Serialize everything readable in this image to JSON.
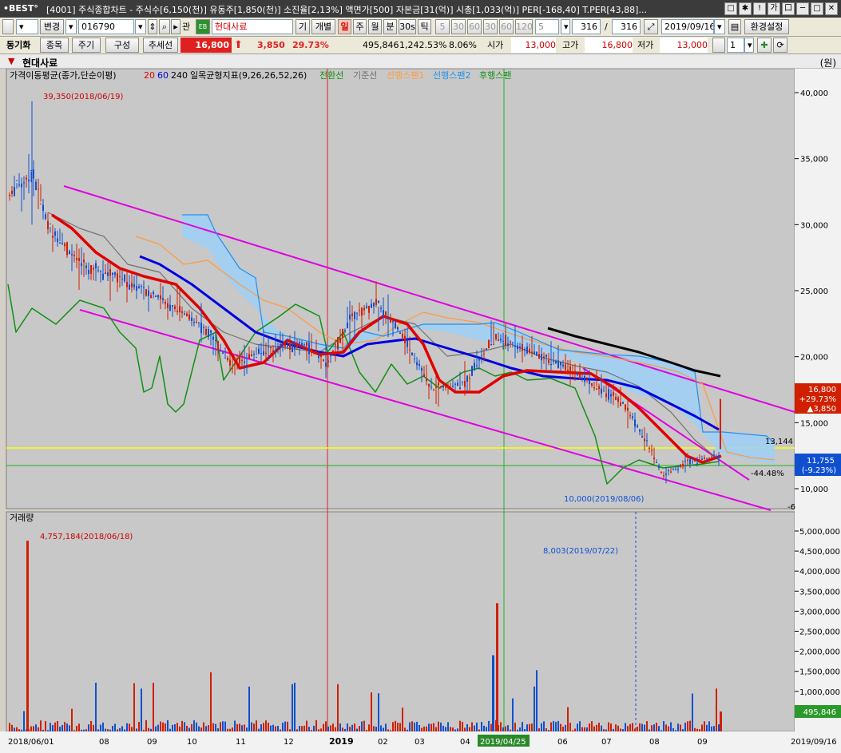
{
  "window": {
    "logo": "•BEST°",
    "title": "[4001] 주식종합차트 - 주식수[6,150(천)] 유동주[1,850(천)] 소진율[2,13%] 액면가[500] 자본금[31(억)] 시총[1,033(억)] PER[-168,40] T.PER[43,88]...",
    "buttons": [
      "□",
      "✱",
      "!",
      "가",
      "口",
      "─",
      "□",
      "✕"
    ]
  },
  "toolbar1": {
    "change_label": "변경",
    "code": "016790",
    "gwan": "관",
    "badge": "EB",
    "stock_name": "현대사료",
    "gi": "기",
    "gaebyeol": "개별",
    "periods": [
      "일",
      "주",
      "월",
      "분",
      "30s",
      "틱"
    ],
    "period_selected": "일",
    "intervals": [
      "5",
      "30",
      "60",
      "30",
      "60",
      "120"
    ],
    "interval_value": "5",
    "count_a": "316",
    "count_sep": "/",
    "count_b": "316",
    "date": "2019/09/16",
    "settings_label": "환경설정"
  },
  "toolbar2": {
    "sync_label": "동기화",
    "buttons": [
      "종목",
      "주기",
      "구성",
      "추세선"
    ],
    "price": "16,800",
    "change": "3,850",
    "change_pct": "29.73%",
    "volume": "495,846",
    "volume_pct": "1,242.53%",
    "turnover_pct": "8.06%",
    "open_label": "시가",
    "open": "13,000",
    "high_label": "고가",
    "high": "16,800",
    "low_label": "저가",
    "low": "13,000",
    "count": "1"
  },
  "chart_header": {
    "stock_name": "현대사료",
    "unit": "(원)"
  },
  "price_panel": {
    "ma_title": "가격이동평균(종가,단순이평)",
    "ma_periods": [
      "20",
      "60",
      "240"
    ],
    "ichimoku_title": "일목균형지표(9,26,26,52,26)",
    "ichimoku_lines": [
      "전환선",
      "기준선",
      "선행스팬1",
      "선행스팬2",
      "후행스팬"
    ],
    "ticks": [
      "40,000",
      "35,000",
      "30,000",
      "25,000",
      "20,000",
      "15,000",
      "10,000"
    ],
    "high_annotation": "39,350(2018/06/19)",
    "low_annotation": "10,000(2019/08/06)",
    "level_label": "13,144",
    "level_pct": "-44.48%",
    "current_box": [
      "16,800",
      "+29.73%",
      "▲3,850"
    ],
    "crosshair_box": [
      "11,755",
      "(-9.23%)"
    ],
    "edge_label": "-6"
  },
  "volume_panel": {
    "title": "거래량",
    "ticks": [
      "5,000,000",
      "4,500,000",
      "4,000,000",
      "3,500,000",
      "3,000,000",
      "2,500,000",
      "2,000,000",
      "1,500,000",
      "1,000,000",
      "500,000"
    ],
    "max_annotation": "4,757,184(2018/06/18)",
    "marker_annotation": "8,003(2019/07/22)",
    "current_box": "495,846"
  },
  "x_axis": {
    "labels": [
      "2018/06/01",
      "08",
      "09",
      "10",
      "11",
      "12",
      "2019",
      "02",
      "03",
      "04",
      "2019/04/25",
      "06",
      "07",
      "08",
      "09"
    ],
    "end_label": "2019/09/16"
  },
  "colors": {
    "ma20": "#e00000",
    "ma60": "#0000e0",
    "ma240": "#000000",
    "channel": "#e000e0",
    "cloud": "#9ed0f8",
    "span1": "#ff9a40",
    "span2": "#2090f0",
    "lagging": "#109010",
    "conversion": "#707070",
    "base": "#a0a0a0",
    "level": "#ffff00",
    "up": "#d02000",
    "down": "#1050d0"
  }
}
